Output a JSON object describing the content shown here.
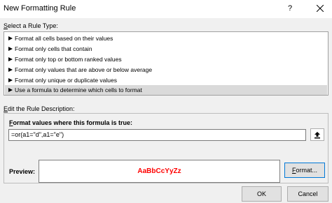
{
  "dialog": {
    "title": "New Formatting Rule",
    "help": "?"
  },
  "rule_type": {
    "label_prefix": "S",
    "label_rest": "elect a Rule Type:",
    "items": [
      {
        "label": "Format all cells based on their values"
      },
      {
        "label": "Format only cells that contain"
      },
      {
        "label": "Format only top or bottom ranked values"
      },
      {
        "label": "Format only values that are above or below average"
      },
      {
        "label": "Format only unique or duplicate values"
      },
      {
        "label": "Use a formula to determine which cells to format",
        "selected": true
      }
    ]
  },
  "description": {
    "label_prefix": "E",
    "label_rest": "dit the Rule Description:",
    "formula_label_prefix": "F",
    "formula_label_rest": "ormat values where this formula is true:",
    "formula_value": "=or(a1=\"d\",a1=\"e\")",
    "preview_label": "Preview:",
    "preview_sample": "AaBbCcYyZz",
    "preview_color": "#ff0000",
    "format_button_prefix": "F",
    "format_button_rest": "ormat..."
  },
  "buttons": {
    "ok": "OK",
    "cancel": "Cancel"
  }
}
